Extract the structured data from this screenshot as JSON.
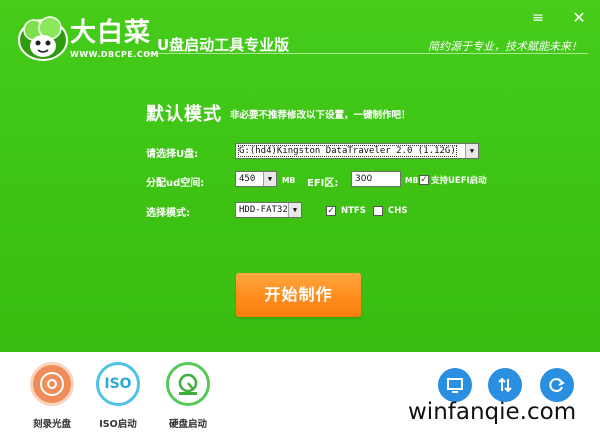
{
  "header": {
    "brand": "大白菜",
    "brand_url": "WWW.DBCPE.COM",
    "app_title": "U盘启动工具专业版",
    "slogan": "简约源于专业，技术赋能未来！",
    "menu_icon": "≡",
    "close_icon": "✕"
  },
  "main": {
    "mode_title": "默认模式",
    "mode_tip": "非必要不推荐修改以下设置，一键制作吧！",
    "usb_label": "请选择U盘:",
    "usb_value": "G:(hd4)Kingston DataTraveler 2.0 (1.12G)",
    "ud_label": "分配ud空间:",
    "ud_value": "450",
    "ud_unit": "MB",
    "efi_label": "EFI区:",
    "efi_value": "300",
    "efi_unit": "MB",
    "uefi_label": "支持UEFI启动",
    "uefi_checked": true,
    "mode_label": "选择模式:",
    "mode_value": "HDD-FAT32",
    "ntfs_label": "NTFS",
    "ntfs_checked": true,
    "chs_label": "CHS",
    "chs_checked": false,
    "start_button": "开始制作"
  },
  "bottom": {
    "tools": [
      {
        "label": "刻录光盘",
        "icon": "disc-icon"
      },
      {
        "label": "ISO启动",
        "icon": "iso-icon",
        "glyph": "ISO"
      },
      {
        "label": "硬盘启动",
        "icon": "harddisk-icon"
      }
    ],
    "right_buttons": [
      {
        "icon": "monitor-icon"
      },
      {
        "icon": "sort-arrows-icon"
      },
      {
        "icon": "refresh-icon"
      }
    ],
    "watermark": "winfanqie.com"
  },
  "colors": {
    "green_bg": "#3fc515",
    "orange_button": "#ff8c1c",
    "blue_button": "#2a8fe0"
  }
}
